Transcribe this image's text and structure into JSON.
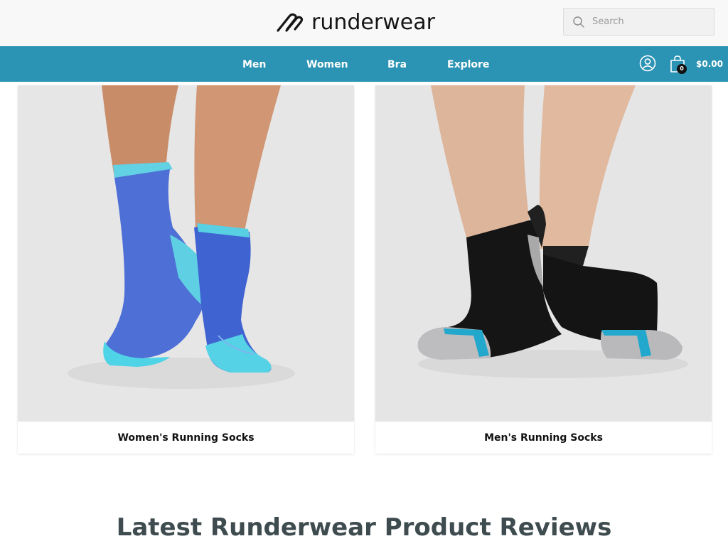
{
  "header": {
    "brand": "runderwear",
    "search": {
      "placeholder": "Search",
      "value": ""
    }
  },
  "nav": {
    "items": [
      {
        "label": "Men"
      },
      {
        "label": "Women"
      },
      {
        "label": "Bra"
      },
      {
        "label": "Explore"
      }
    ],
    "account_icon": "user-circle-icon",
    "cart": {
      "icon": "shopping-bag-icon",
      "count": "0",
      "total": "$0.00"
    }
  },
  "colors": {
    "nav_bar": "#2b93b4",
    "top_bar": "#f8f8f8",
    "heading": "#3e4b4f"
  },
  "categories": [
    {
      "label": "Women's Running Socks",
      "image": "photo of feet wearing blue and turquoise quarter-length running socks"
    },
    {
      "label": "Men's Running Socks",
      "image": "photo of feet wearing black no-show running socks with grey cushioned toes and blue stripe"
    }
  ],
  "reviews": {
    "heading": "Latest Runderwear Product Reviews"
  }
}
